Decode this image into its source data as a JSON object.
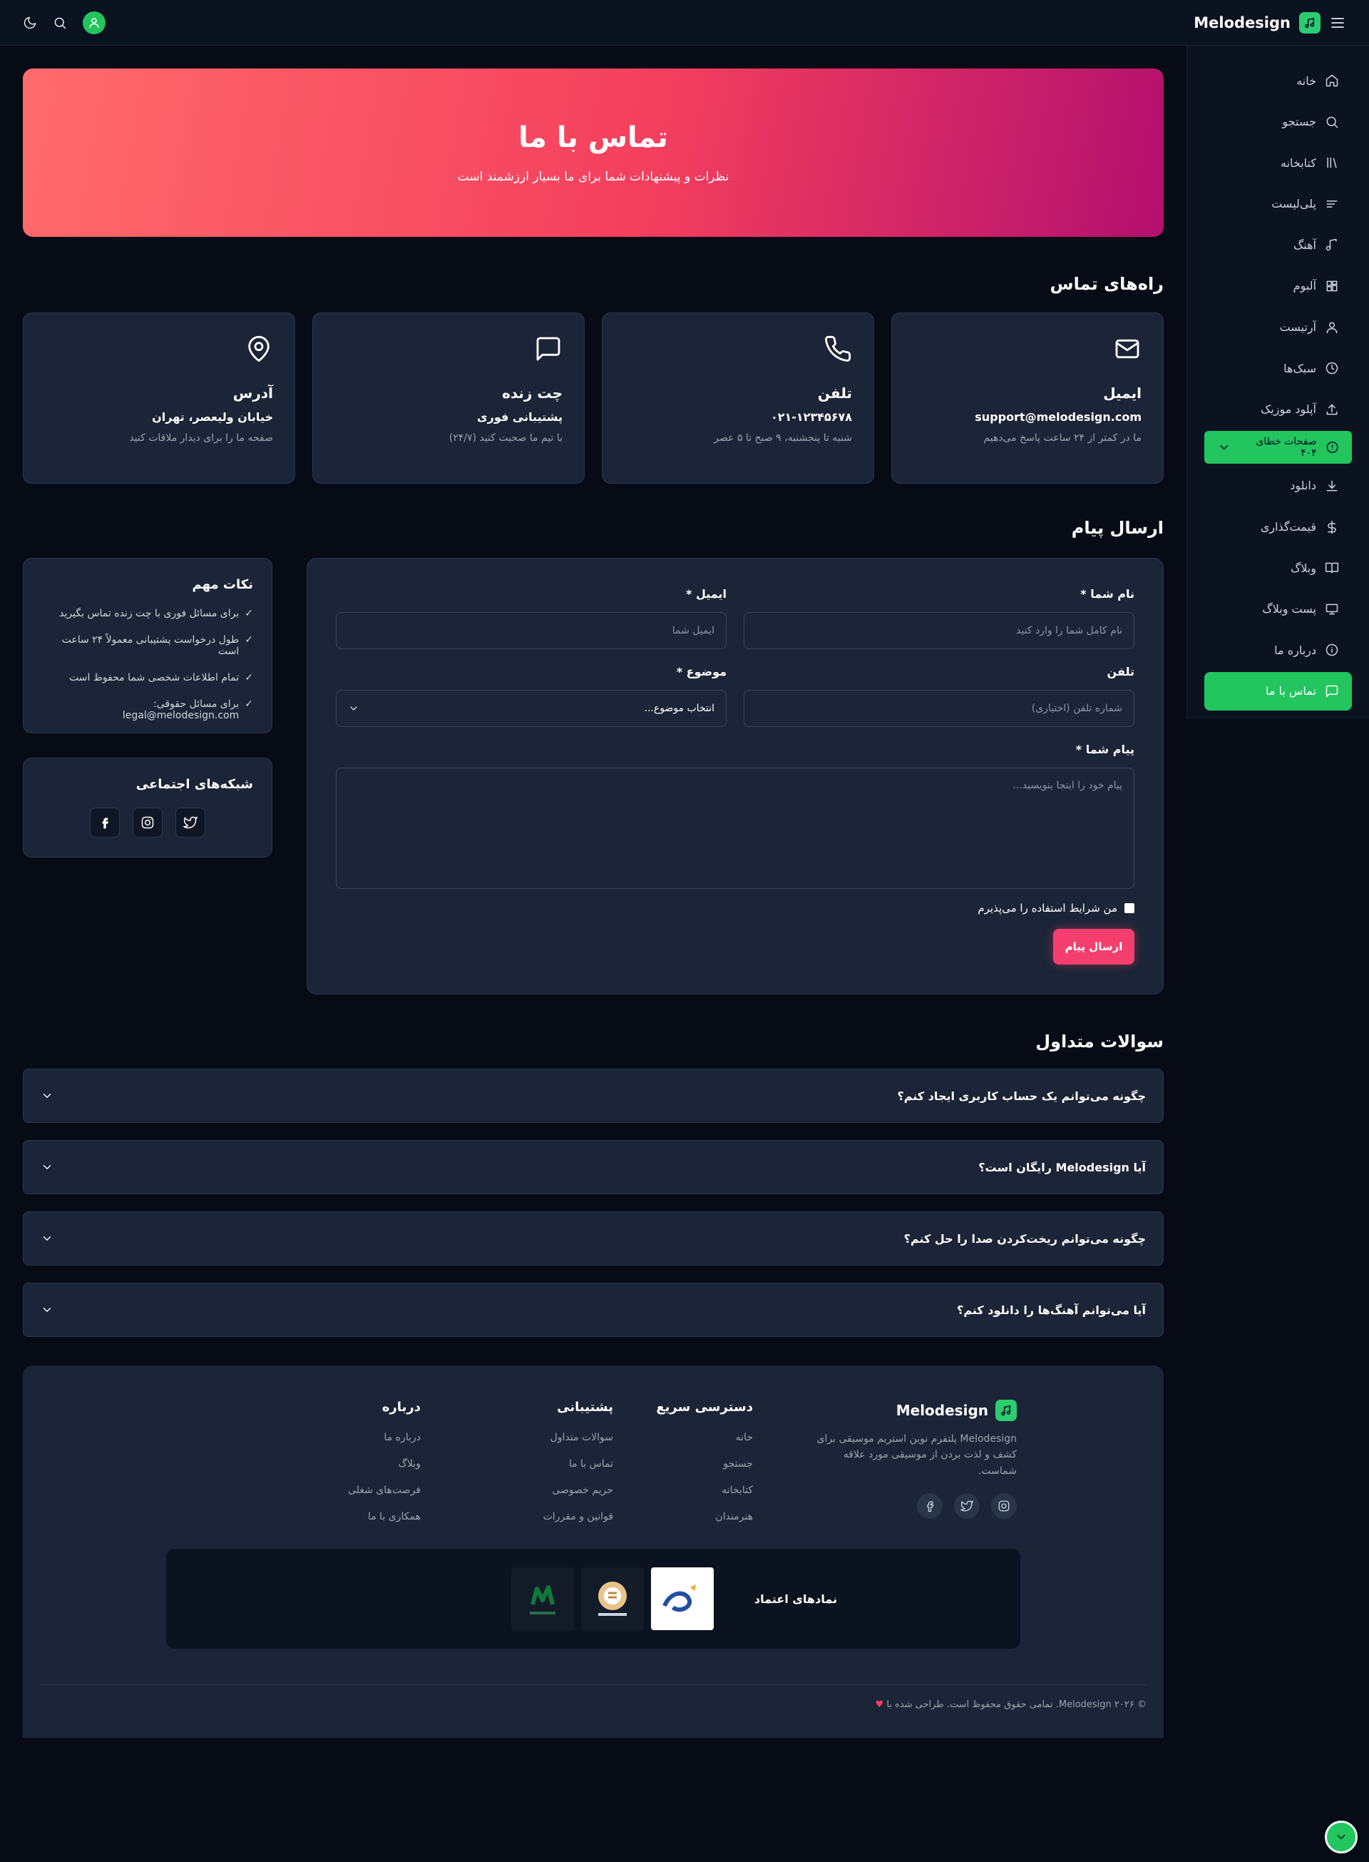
{
  "app": {
    "brand": "Melodesign"
  },
  "sidebar": {
    "items": [
      {
        "label": "خانه"
      },
      {
        "label": "جستجو"
      },
      {
        "label": "کتابخانه"
      },
      {
        "label": "پلی‌لیست"
      },
      {
        "label": "آهنگ"
      },
      {
        "label": "آلبوم"
      },
      {
        "label": "آرتیست"
      },
      {
        "label": "سبک‌ها"
      },
      {
        "label": "آپلود موزیک"
      },
      {
        "label": "صفحات خطای ۴۰۴"
      },
      {
        "label": "دانلود"
      },
      {
        "label": "قیمت‌گذاری"
      },
      {
        "label": "وبلاگ"
      },
      {
        "label": "پست وبلاگ"
      },
      {
        "label": "درباره ما"
      },
      {
        "label": "تماس با ما"
      }
    ]
  },
  "hero": {
    "title": "تماس با ما",
    "subtitle": "نظرات و پیشنهادات شما برای ما بسیار ارزشمند است"
  },
  "contact": {
    "title": "راه‌های تماس",
    "cards": [
      {
        "icon": "mail-icon",
        "title": "ایمیل",
        "value": "support@melodesign.com",
        "note": "ما در کمتر از ۲۴ ساعت پاسخ می‌دهیم"
      },
      {
        "icon": "phone-icon",
        "title": "تلفن",
        "value": "۰۲۱-۱۲۳۴۵۶۷۸",
        "note": "شنبه تا پنجشنبه، ۹ صبح تا ۵ عصر"
      },
      {
        "icon": "chat-icon",
        "title": "چت زنده",
        "value": "پشتیبانی فوری",
        "note": "با تیم ما صحبت کنید (۲۴/۷)"
      },
      {
        "icon": "location-icon",
        "title": "آدرس",
        "value": "خیابان ولیعصر، تهران",
        "note": "صفحه ما را برای دیدار ملاقات کنید"
      }
    ]
  },
  "form": {
    "title": "ارسال پیام",
    "name_label": "نام شما *",
    "name_placeholder": "نام کامل شما را وارد کنید",
    "email_label": "ایمیل *",
    "email_placeholder": "ایمیل شما",
    "phone_label": "تلفن",
    "phone_placeholder": "شماره تلفن (اختیاری)",
    "subject_label": "موضوع *",
    "subject_value": "انتخاب موضوع...",
    "message_label": "پیام شما *",
    "message_placeholder": "پیام خود را اینجا بنویسید...",
    "terms": "من شرایط استفاده را می‌پذیرم",
    "submit": "ارسال پیام"
  },
  "tips": {
    "title": "نکات مهم",
    "items": [
      "برای مسائل فوری با چت زنده تماس بگیرید",
      "طول درخواست پشتیبانی معمولاً ۲۴ ساعت است",
      "تمام اطلاعات شخصی شما محفوظ است",
      "برای مسائل حقوقی: legal@melodesign.com"
    ],
    "check": "✓"
  },
  "social": {
    "title": "شبکه‌های اجتماعی"
  },
  "faq": {
    "title": "سوالات متداول",
    "items": [
      "چگونه می‌توانم یک حساب کاربری ایجاد کنم؟",
      "آیا Melodesign رایگان است؟",
      "چگونه می‌توانم ریخت‌کردن صدا را حل کنم؟",
      "آیا می‌توانم آهنگ‌ها را دانلود کنم؟"
    ]
  },
  "footer": {
    "brand": "Melodesign",
    "about": "Melodesign پلتفرم نوین استریم موسیقی برای کشف و لذت بردن از موسیقی مورد علاقه شماست.",
    "quick": {
      "title": "دسترسی سریع",
      "links": [
        "خانه",
        "جستجو",
        "کتابخانه",
        "هنرمندان"
      ]
    },
    "support": {
      "title": "پشتیبانی",
      "links": [
        "سوالات متداول",
        "تماس با ما",
        "حریم خصوصی",
        "قوانین و مقررات"
      ]
    },
    "aboutcol": {
      "title": "درباره",
      "links": [
        "درباره ما",
        "وبلاگ",
        "فرصت‌های شغلی",
        "همکاری با ما"
      ]
    },
    "trust_title": "نمادهای اعتماد",
    "copyright": "© ۲۰۲۶ Melodesign. تمامی حقوق محفوظ است. طراحی شده با",
    "heart": "♥"
  },
  "colors": {
    "accent": "#22c55e",
    "cta": "#f43f6e",
    "panel": "#1b2537",
    "bg": "#060b16"
  }
}
